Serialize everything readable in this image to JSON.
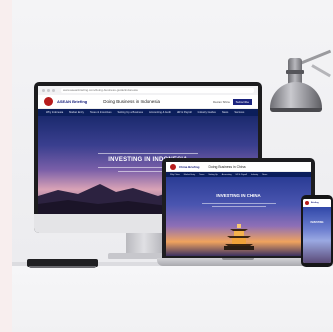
{
  "monitor": {
    "url": "www.aseanbriefing.com/doing-business-guide/indonesia",
    "brand": "ASEAN Briefing",
    "doing_business": "Doing Business in Indonesia",
    "head_chips": [
      "Dezan Shira",
      "Subscribe"
    ],
    "nav_items": [
      "Why Indonesia",
      "Market Entry",
      "Taxes & Incentives",
      "Setting Up a Business",
      "Accounting & Audit",
      "HR & Payroll",
      "Industry Guides",
      "News",
      "Services"
    ],
    "hero_title": "INVESTING IN INDONESIA"
  },
  "laptop": {
    "brand": "China Briefing",
    "doing_business": "Doing Business in China",
    "nav_items": [
      "Why China",
      "Market Entry",
      "Taxes",
      "Setting Up",
      "Accounting",
      "HR & Payroll",
      "Industry",
      "News"
    ],
    "hero_title": "INVESTING IN CHINA"
  },
  "phone": {
    "brand": "Briefing",
    "hero_title": "INVESTING"
  },
  "colors": {
    "brand_navy": "#0b1e5b",
    "logo_red": "#b71c1c",
    "background": "#efeff1"
  }
}
